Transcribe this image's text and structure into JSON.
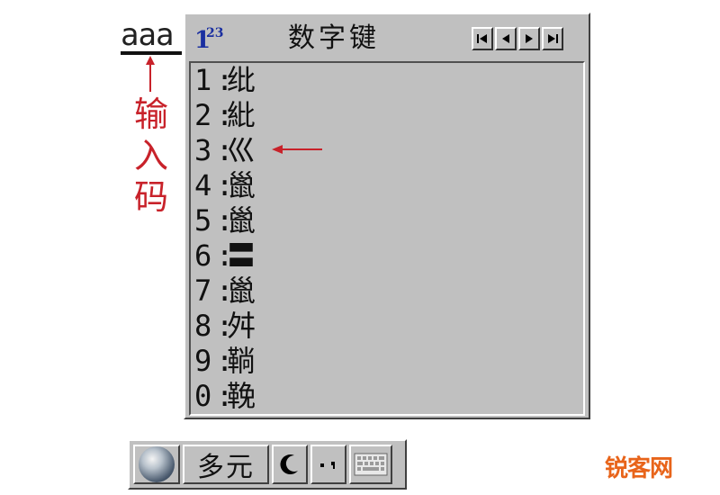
{
  "input": {
    "code": "aaa",
    "caption": "输\n入\n码",
    "annotation_color": "#c8222a"
  },
  "window": {
    "mode_icon": {
      "name": "123-icon",
      "big": "1",
      "sup": "23"
    },
    "title": "数字键",
    "nav_buttons": [
      "first-page-icon",
      "prev-page-icon",
      "next-page-icon",
      "last-page-icon"
    ],
    "candidates": [
      {
        "num": "1",
        "char": "纰"
      },
      {
        "num": "2",
        "char": "紕"
      },
      {
        "num": "3",
        "char": "巛"
      },
      {
        "num": "4",
        "char": "巤"
      },
      {
        "num": "5",
        "char": "巤"
      },
      {
        "num": "6",
        "char": "〓"
      },
      {
        "num": "7",
        "char": "巤"
      },
      {
        "num": "8",
        "char": "舛"
      },
      {
        "num": "9",
        "char": "鞝"
      },
      {
        "num": "0",
        "char": "鞔"
      }
    ],
    "separator": ":"
  },
  "status_bar": {
    "ime_name": "多元",
    "icons": [
      "globe-icon",
      "half-width-moon-icon",
      "punctuation-icon",
      "soft-keyboard-icon"
    ]
  },
  "watermark": "锐客网"
}
